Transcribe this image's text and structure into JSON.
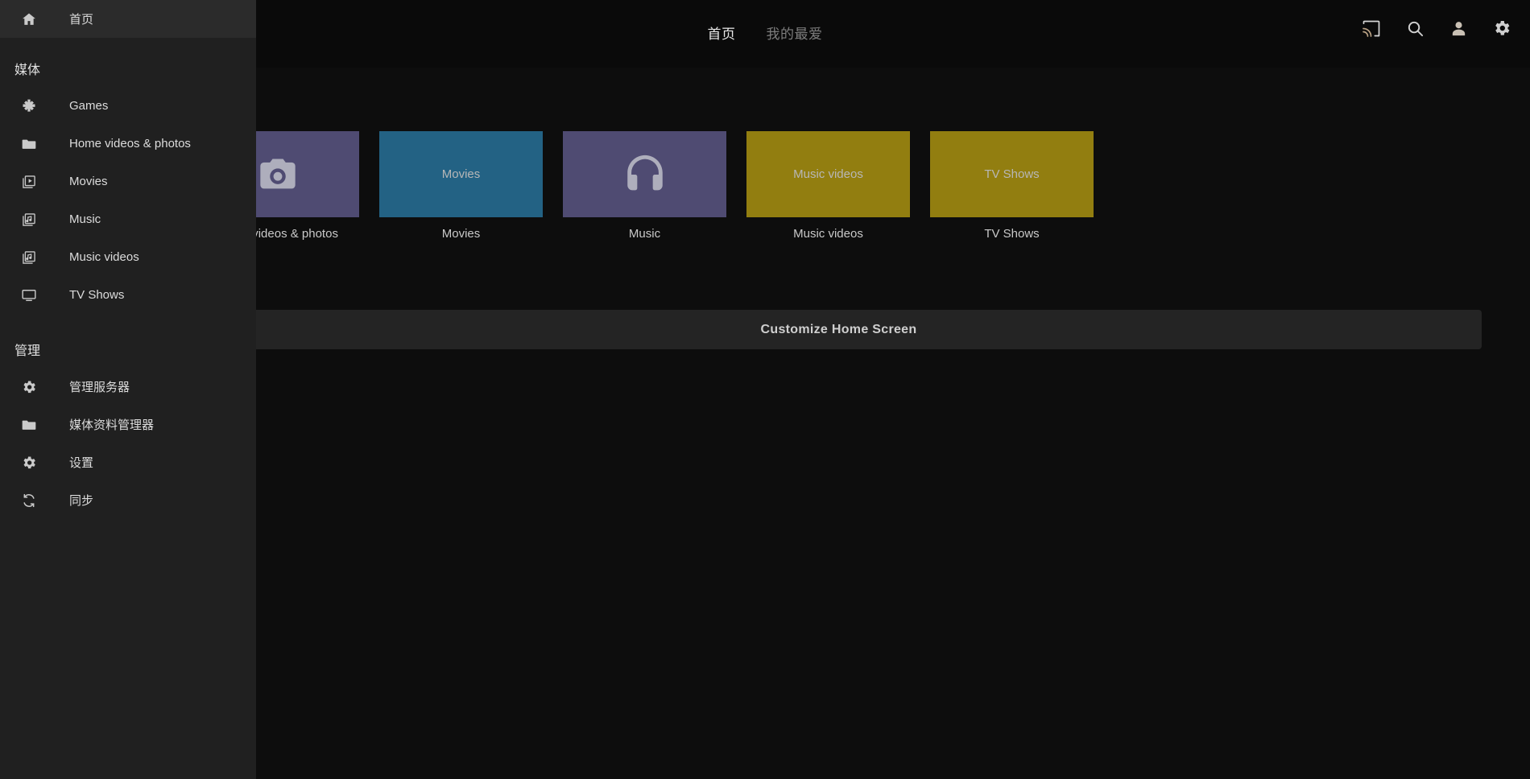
{
  "header": {
    "tabs": [
      {
        "label": "首页",
        "active": true
      },
      {
        "label": "我的最爱",
        "active": false
      }
    ],
    "icons": [
      {
        "name": "cast-icon"
      },
      {
        "name": "search-icon"
      },
      {
        "name": "person-icon"
      },
      {
        "name": "gear-icon"
      }
    ]
  },
  "sidebar": {
    "home": {
      "label": "首页",
      "icon": "home-icon"
    },
    "section_media": {
      "label": "媒体"
    },
    "media_items": [
      {
        "label": "Games",
        "icon": "gamepad-icon"
      },
      {
        "label": "Home videos & photos",
        "icon": "folder-icon"
      },
      {
        "label": "Movies",
        "icon": "movie-icon"
      },
      {
        "label": "Music",
        "icon": "music-icon"
      },
      {
        "label": "Music videos",
        "icon": "music-video-icon"
      },
      {
        "label": "TV Shows",
        "icon": "tv-icon"
      }
    ],
    "section_admin": {
      "label": "管理"
    },
    "admin_items": [
      {
        "label": "管理服务器",
        "icon": "gear-icon"
      },
      {
        "label": "媒体资料管理器",
        "icon": "folder-icon"
      },
      {
        "label": "设置",
        "icon": "gear-icon"
      },
      {
        "label": "同步",
        "icon": "sync-icon"
      }
    ]
  },
  "main": {
    "tiles": [
      {
        "caption": "Home videos & photos",
        "overlay_text": "",
        "icon": "camera-icon",
        "color": "#4f4b72"
      },
      {
        "caption": "Movies",
        "overlay_text": "Movies",
        "icon": "",
        "color": "#236284"
      },
      {
        "caption": "Music",
        "overlay_text": "",
        "icon": "headphones-icon",
        "color": "#4f4b72"
      },
      {
        "caption": "Music videos",
        "overlay_text": "Music videos",
        "icon": "",
        "color": "#927e10"
      },
      {
        "caption": "TV Shows",
        "overlay_text": "TV Shows",
        "icon": "",
        "color": "#927e10"
      }
    ],
    "customize_label": "Customize Home Screen"
  },
  "colors": {
    "sidebar_bg": "#202020",
    "main_bg": "#0d0d0d",
    "header_bg": "#0a0a0a",
    "purple": "#4f4b72",
    "blue": "#236284",
    "gold": "#927e10",
    "bar_bg": "#242424"
  }
}
